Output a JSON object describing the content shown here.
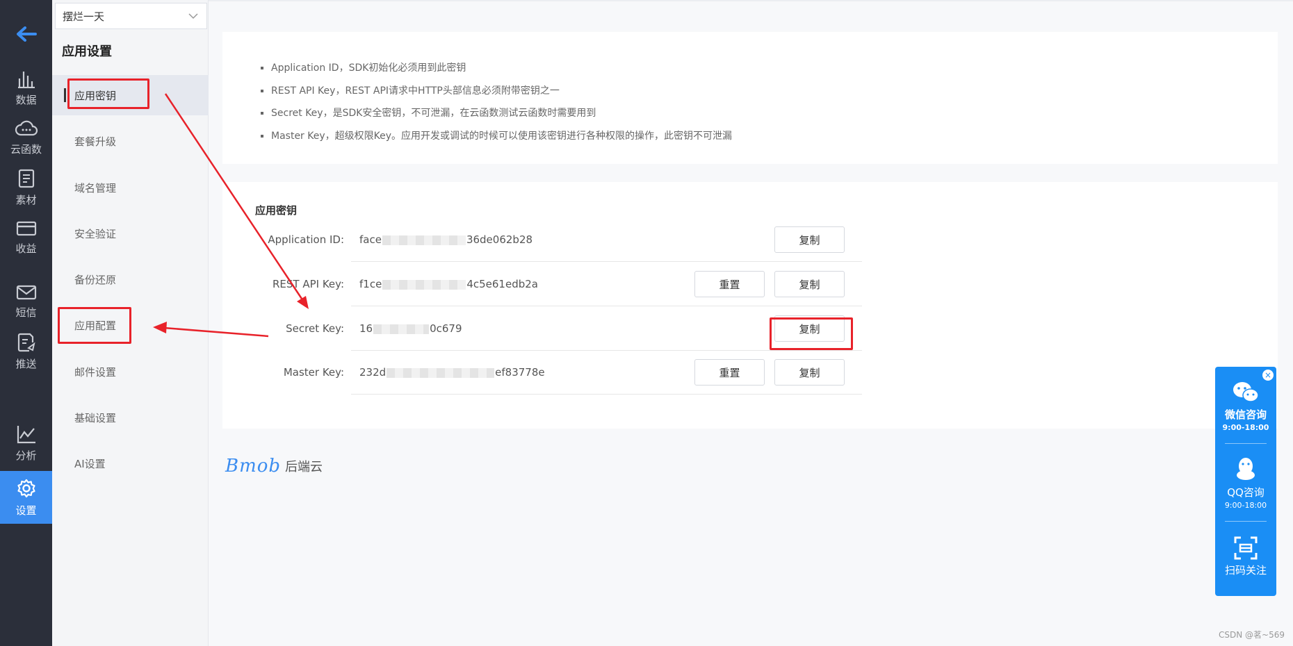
{
  "rail": {
    "items": [
      {
        "label": "数据",
        "icon": "bar-chart-icon"
      },
      {
        "label": "云函数",
        "icon": "cloud-icon"
      },
      {
        "label": "素材",
        "icon": "document-icon"
      },
      {
        "label": "收益",
        "icon": "card-icon"
      },
      {
        "label": "短信",
        "icon": "mail-icon"
      },
      {
        "label": "推送",
        "icon": "push-icon"
      },
      {
        "label": "分析",
        "icon": "line-chart-icon"
      },
      {
        "label": "设置",
        "icon": "gear-icon"
      }
    ]
  },
  "sidebar": {
    "app_name": "摆烂一天",
    "title": "应用设置",
    "items": [
      "应用密钥",
      "套餐升级",
      "域名管理",
      "安全验证",
      "备份还原",
      "应用配置",
      "邮件设置",
      "基础设置",
      "AI设置"
    ]
  },
  "tips": [
    "Application ID，SDK初始化必须用到此密钥",
    "REST API Key，REST API请求中HTTP头部信息必须附带密钥之一",
    "Secret Key，是SDK安全密钥，不可泄漏，在云函数测试云函数时需要用到",
    "Master Key，超级权限Key。应用开发或调试的时候可以使用该密钥进行各种权限的操作，此密钥不可泄漏"
  ],
  "keys": {
    "title": "应用密钥",
    "reset_label": "重置",
    "copy_label": "复制",
    "rows": [
      {
        "label": "Application ID:",
        "prefix": "face",
        "suffix": "36de062b28"
      },
      {
        "label": "REST API Key:",
        "prefix": "f1ce",
        "suffix": "4c5e61edb2a"
      },
      {
        "label": "Secret Key:",
        "prefix": "16",
        "suffix": "0c679"
      },
      {
        "label": "Master Key:",
        "prefix": "232d",
        "suffix": "ef83778e"
      }
    ]
  },
  "brand": {
    "logo": "Bmob",
    "text": "后端云"
  },
  "float": {
    "close": "×",
    "wechat_title": "微信咨询",
    "wechat_hours": "9:00-18:00",
    "qq_title": "QQ咨询",
    "qq_hours": "9:00-18:00",
    "scan_title": "扫码关注"
  },
  "watermark": "CSDN @茗~569",
  "colors": {
    "accent": "#3b8df0",
    "highlight": "#e8222a",
    "rail_bg": "#2b2f3a"
  }
}
